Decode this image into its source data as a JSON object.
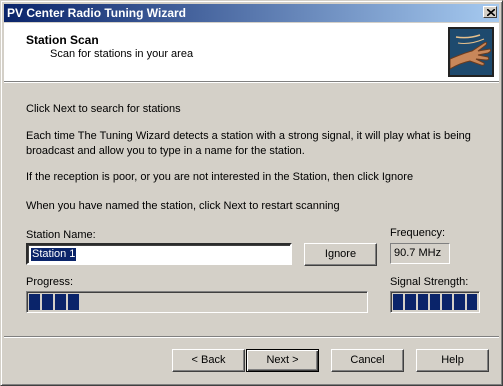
{
  "window": {
    "title": "PV Center Radio Tuning Wizard"
  },
  "header": {
    "title": "Station Scan",
    "subtitle": "Scan for stations in your area"
  },
  "body": {
    "line1": "Click Next to search for stations",
    "line2": "Each time The Tuning Wizard detects a station with a strong signal, it will play what is being broadcast and allow you to type in a name for the station.",
    "line3": "If the reception is poor, or you are not interested in the Station, then click Ignore",
    "line4": "When you have named the station, click Next to restart scanning"
  },
  "station": {
    "label": "Station Name:",
    "value": "Station 1",
    "ignore_label": "Ignore"
  },
  "frequency": {
    "label": "Frequency:",
    "value": "90.7 MHz"
  },
  "progress": {
    "label": "Progress:",
    "segments_filled": 4
  },
  "signal": {
    "label": "Signal Strength:",
    "segments_filled": 7
  },
  "footer": {
    "back_label": "< Back",
    "next_label": "Next >",
    "cancel_label": "Cancel",
    "help_label": "Help"
  },
  "colors": {
    "title_start": "#0a246a",
    "title_end": "#a6caf0",
    "face": "#d4d0c8",
    "meter_fill": "#0a246a"
  },
  "icons": {
    "close": "close-icon",
    "logo": "wizard-hand-logo"
  }
}
